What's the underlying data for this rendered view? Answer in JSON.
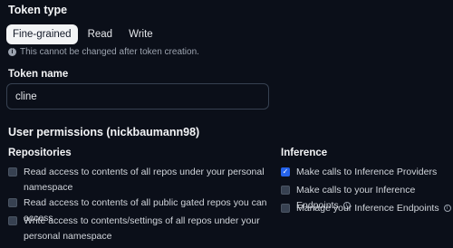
{
  "token_type": {
    "title": "Token type",
    "tabs": [
      {
        "label": "Fine-grained",
        "active": true
      },
      {
        "label": "Read",
        "active": false
      },
      {
        "label": "Write",
        "active": false
      }
    ],
    "hint_icon": "info-icon",
    "hint": "This cannot be changed after token creation."
  },
  "token_name": {
    "label": "Token name",
    "value": "cline"
  },
  "user_permissions": {
    "title": "User permissions (nickbaumann98)",
    "repositories": {
      "heading": "Repositories",
      "items": [
        {
          "label": "Read access to contents of all repos under your personal namespace",
          "checked": false
        },
        {
          "label": "Read access to contents of all public gated repos you can access",
          "checked": false
        },
        {
          "label": "Write access to contents/settings of all repos under your personal namespace",
          "checked": false
        }
      ]
    },
    "inference": {
      "heading": "Inference",
      "items": [
        {
          "label": "Make calls to Inference Providers",
          "checked": true,
          "info": false
        },
        {
          "label": "Make calls to your Inference Endpoints",
          "checked": false,
          "info": true
        },
        {
          "label": "Manage your Inference Endpoints",
          "checked": false,
          "info": true
        }
      ]
    }
  },
  "colors": {
    "background": "#0b0f19",
    "checkbox_checked": "#2563eb",
    "active_tab_bg": "#f3f4f6"
  }
}
